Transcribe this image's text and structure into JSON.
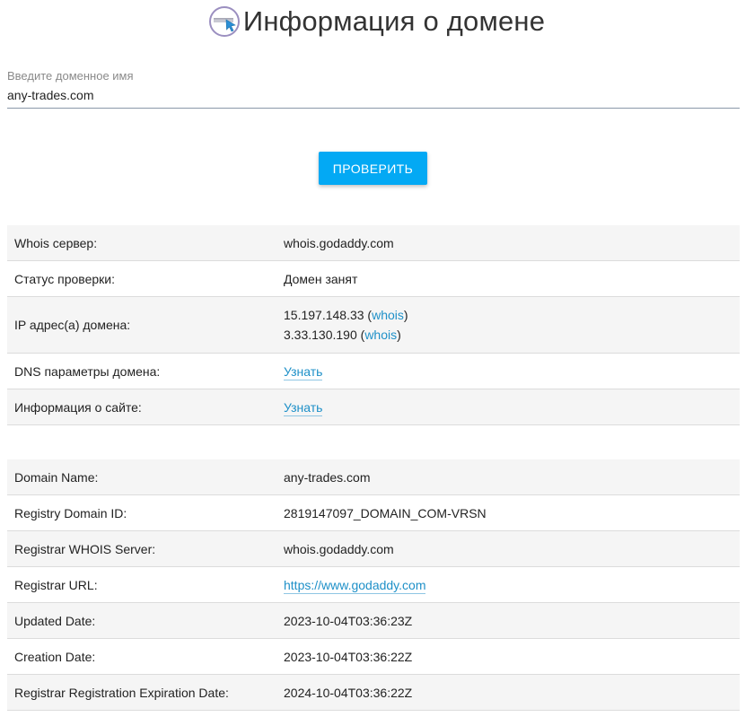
{
  "page": {
    "title": "Информация о домене",
    "logo_icon": "domain-cursor-icon"
  },
  "search": {
    "label": "Введите доменное имя",
    "value": "any-trades.com",
    "button_label": "ПРОВЕРИТЬ"
  },
  "summary": {
    "whois_server_label": "Whois сервер:",
    "whois_server_value": "whois.godaddy.com",
    "status_label": "Статус проверки:",
    "status_value": "Домен занят",
    "ip_label": "IP адрес(а) домена:",
    "ips": [
      {
        "ip": "15.197.148.33",
        "link": "whois"
      },
      {
        "ip": "3.33.130.190",
        "link": "whois"
      }
    ],
    "dns_label": "DNS параметры домена:",
    "dns_link": "Узнать",
    "site_label": "Информация о сайте:",
    "site_link": "Узнать"
  },
  "whois": {
    "rows": [
      {
        "key": "Domain Name:",
        "value": "any-trades.com"
      },
      {
        "key": "Registry Domain ID:",
        "value": "2819147097_DOMAIN_COM-VRSN"
      },
      {
        "key": "Registrar WHOIS Server:",
        "value": "whois.godaddy.com"
      },
      {
        "key": "Registrar URL:",
        "value": "https://www.godaddy.com"
      },
      {
        "key": "Updated Date:",
        "value": "2023-10-04T03:36:23Z"
      },
      {
        "key": "Creation Date:",
        "value": "2023-10-04T03:36:22Z"
      },
      {
        "key": "Registrar Registration Expiration Date:",
        "value": "2024-10-04T03:36:22Z"
      }
    ]
  },
  "colors": {
    "accent": "#03a9f4",
    "link": "#1e90c8",
    "row_alt": "#f5f5f5"
  }
}
